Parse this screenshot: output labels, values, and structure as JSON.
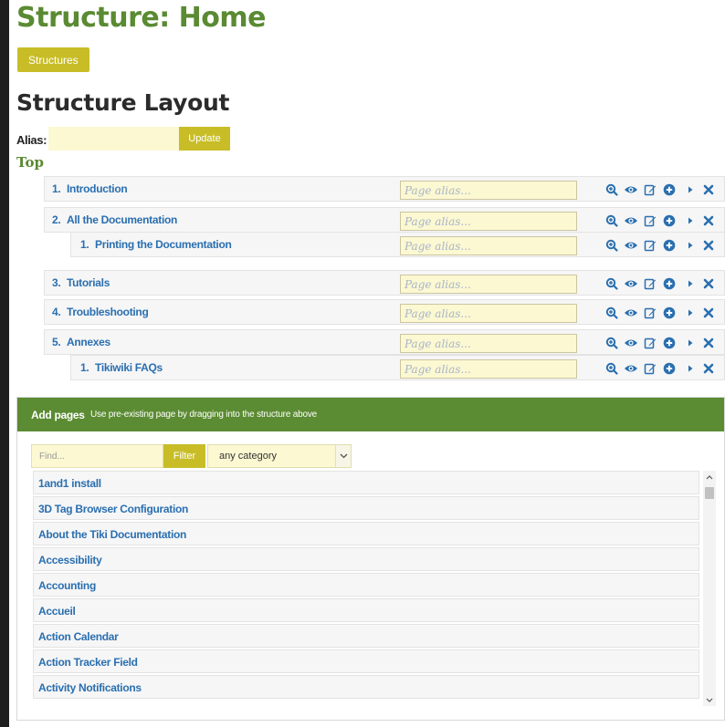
{
  "page": {
    "title": "Structure: Home",
    "structures_button": "Structures",
    "layout_heading": "Structure Layout",
    "alias_label": "Alias:",
    "alias_value": "",
    "update_button": "Update",
    "top_label": "Top"
  },
  "structure": [
    {
      "num": "1.",
      "label": "Introduction",
      "alias_placeholder": "Page alias..."
    },
    {
      "num": "2.",
      "label": "All the Documentation",
      "alias_placeholder": "Page alias..."
    },
    {
      "num": "1.",
      "label": "Printing the Documentation",
      "alias_placeholder": "Page alias..."
    },
    {
      "num": "3.",
      "label": "Tutorials",
      "alias_placeholder": "Page alias..."
    },
    {
      "num": "4.",
      "label": "Troubleshooting",
      "alias_placeholder": "Page alias..."
    },
    {
      "num": "5.",
      "label": "Annexes",
      "alias_placeholder": "Page alias..."
    },
    {
      "num": "1.",
      "label": "Tikiwiki FAQs",
      "alias_placeholder": "Page alias..."
    }
  ],
  "row_actions": [
    "zoom-in-icon",
    "eye-icon",
    "edit-icon",
    "plus-circle-icon",
    "caret-right-icon",
    "close-icon"
  ],
  "add_pages": {
    "heading": "Add pages",
    "description": "Use pre-existing page by dragging into the structure above",
    "find_placeholder": "Find...",
    "filter_button": "Filter",
    "category_selected": "any category",
    "pages": [
      "1and1 install",
      "3D Tag Browser Configuration",
      "About the Tiki Documentation",
      "Accessibility",
      "Accounting",
      "Accueil",
      "Action Calendar",
      "Action Tracker Field",
      "Activity Notifications"
    ]
  },
  "colors": {
    "title_green": "#5a8a32",
    "button_olive": "#c8bd27",
    "link_blue": "#2a6fb0",
    "input_yellow": "#fbf8d2",
    "panel_header_green": "#5b8b32"
  }
}
